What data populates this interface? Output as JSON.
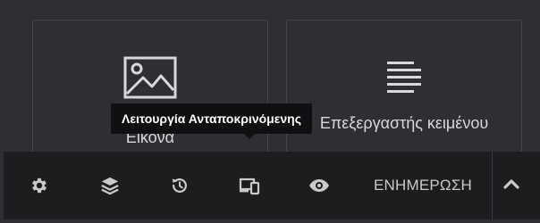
{
  "widgets": {
    "image": {
      "label": "Εικόνα",
      "icon": "image-icon"
    },
    "text_editor": {
      "label": "Επεξεργαστής κειμένου",
      "icon": "text-align-left-icon"
    }
  },
  "tooltip": {
    "text": "Λειτουργία Ανταποκρινόμενης"
  },
  "toolbar": {
    "buttons": [
      {
        "icon": "gear-icon"
      },
      {
        "icon": "layers-icon"
      },
      {
        "icon": "history-icon"
      },
      {
        "icon": "responsive-mode-icon"
      },
      {
        "icon": "eye-icon"
      }
    ],
    "update_label": "ΕΝΗΜΕΡΩΣΗ",
    "collapse_icon": "chevron-up-icon"
  },
  "colors": {
    "background": "#2e2f32",
    "toolbar": "#1c1d1f",
    "icon": "#c9cacc",
    "tooltip": "#0f1011"
  }
}
